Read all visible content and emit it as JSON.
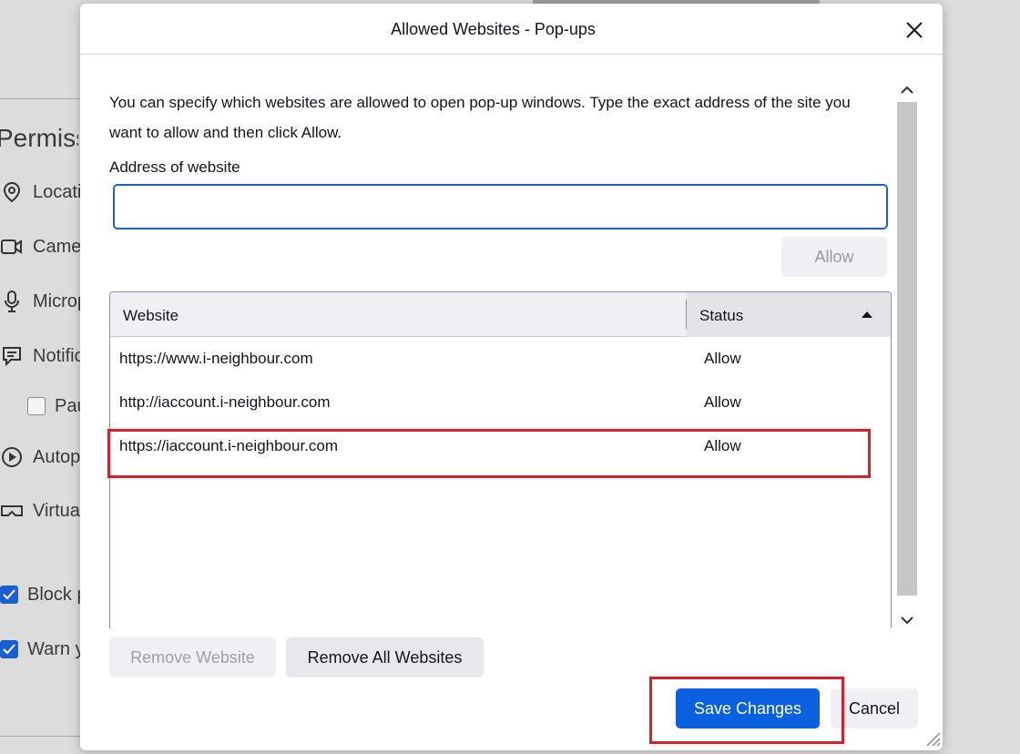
{
  "background": {
    "heading": "Permissions",
    "items": [
      {
        "label": "Location",
        "icon": "location-pin-icon"
      },
      {
        "label": "Camera",
        "icon": "camera-icon"
      },
      {
        "label": "Microphone",
        "icon": "microphone-icon"
      },
      {
        "label": "Notifications",
        "icon": "notification-icon"
      },
      {
        "label": "Pause notifications",
        "icon": "checkbox"
      },
      {
        "label": "Autoplay",
        "icon": "autoplay-icon"
      },
      {
        "label": "Virtual Reality",
        "icon": "vr-headset-icon"
      }
    ],
    "checks": [
      {
        "label": "Block pop-up windows",
        "checked": true
      },
      {
        "label": "Warn you",
        "checked": true
      }
    ]
  },
  "dialog": {
    "title": "Allowed Websites - Pop-ups",
    "description": "You can specify which websites are allowed to open pop-up windows. Type the exact address of the site you want to allow and then click Allow.",
    "address_label": "Address of website",
    "address_value": "",
    "address_placeholder": "",
    "allow_label": "Allow",
    "table": {
      "headers": {
        "website": "Website",
        "status": "Status"
      },
      "rows": [
        {
          "website": "https://www.i-neighbour.com",
          "status": "Allow"
        },
        {
          "website": "http://iaccount.i-neighbour.com",
          "status": "Allow"
        },
        {
          "website": "https://iaccount.i-neighbour.com",
          "status": "Allow"
        }
      ]
    },
    "remove_website_label": "Remove Website",
    "remove_all_label": "Remove All Websites",
    "save_label": "Save Changes",
    "cancel_label": "Cancel"
  },
  "colors": {
    "accent": "#0a60df",
    "focus_border": "#1f5fc9",
    "highlight": "#d9202a"
  }
}
